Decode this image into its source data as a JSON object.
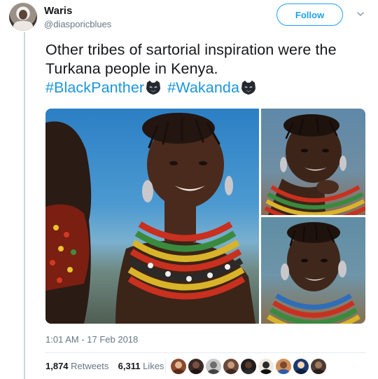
{
  "user": {
    "name": "Waris",
    "handle": "@diasporicblues"
  },
  "follow_label": "Follow",
  "tweet": {
    "text_plain": "Other tribes of sartorial inspiration were the Turkana people in Kenya.",
    "hashtag_1": "#BlackPanther",
    "hashtag_2": "#Wakanda"
  },
  "timestamp": "1:01 AM - 17 Feb 2018",
  "stats": {
    "retweets_count": "1,874",
    "retweets_label": "Retweets",
    "likes_count": "6,311",
    "likes_label": "Likes"
  },
  "colors": {
    "link_blue": "#1b95e0",
    "follow_blue": "#1da1f2",
    "meta_gray": "#657786"
  },
  "icons": [
    "chevron-down-icon",
    "black-panther-emoji"
  ],
  "liker_avatars": [
    {
      "bg": "#8a4a2f"
    },
    {
      "bg": "#3a2a25"
    },
    {
      "bg": "#c9c9c9"
    },
    {
      "bg": "#6b4a3b"
    },
    {
      "bg": "#1d1d1d"
    },
    {
      "bg": "#f0e9dc"
    },
    {
      "bg": "#d08f5b"
    },
    {
      "bg": "#1d3a6e"
    },
    {
      "bg": "#4a3b33"
    }
  ]
}
